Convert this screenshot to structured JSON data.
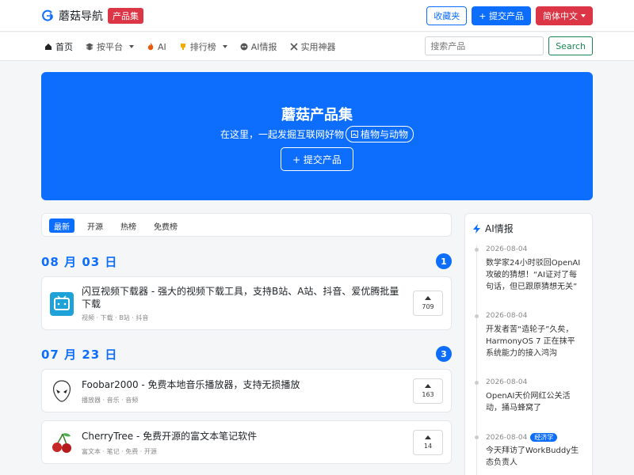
{
  "brand": {
    "name": "蘑菇导航",
    "badge": "产品集"
  },
  "top_actions": {
    "favorites": "收藏夹",
    "submit": "+ 提交产品",
    "language": "简体中文"
  },
  "nav": {
    "items": [
      {
        "label": "首页",
        "icon": "home-icon"
      },
      {
        "label": "按平台",
        "icon": "layers-icon"
      },
      {
        "label": "AI",
        "icon": "fire-icon"
      },
      {
        "label": "排行榜",
        "icon": "trophy-icon"
      },
      {
        "label": "AI情报",
        "icon": "robot-icon"
      },
      {
        "label": "实用神器",
        "icon": "tools-icon"
      }
    ],
    "search_placeholder": "搜索产品",
    "search_button": "Search"
  },
  "hero": {
    "title": "蘑菇产品集",
    "subtitle": "在这里，一起发掘互联网好物",
    "tag": "植物与动物",
    "button": "+ 提交产品"
  },
  "tabs": [
    "最新",
    "开源",
    "热榜",
    "免费榜"
  ],
  "groups": [
    {
      "date": "08 月 03 日",
      "count": "1",
      "products": [
        {
          "title": "闪豆视频下载器 - 强大的视频下载工具，支持B站、A站、抖音、爱优腾批量下载",
          "tags": "视频 · 下载 · B站 · 抖音",
          "votes": "709"
        }
      ]
    },
    {
      "date": "07 月 23 日",
      "count": "3",
      "products": [
        {
          "title": "Foobar2000 - 免费本地音乐播放器，支持无损播放",
          "tags": "播放器 · 音乐 · 音频",
          "votes": "163"
        },
        {
          "title": "CherryTree - 免费开源的富文本笔记软件",
          "tags": "富文本 · 笔记 · 免费 · 开源",
          "votes": "14"
        }
      ]
    }
  ],
  "sidebar": {
    "title": "AI情报",
    "news": [
      {
        "date": "2026-08-04",
        "text": "数学家24小时驳回OpenAI攻破的猜想！“AI证对了每句话，但已跟原猜想无关”"
      },
      {
        "date": "2026-08-04",
        "text": "开发者苦“造轮子”久矣，HarmonyOS 7 正在抹平系统能力的接入鸿沟"
      },
      {
        "date": "2026-08-04",
        "text": "OpenAI天价网红公关活动，捅马蜂窝了"
      },
      {
        "date": "2026-08-04",
        "tag": "经济学",
        "text": "今天拜访了WorkBuddy生态负责人"
      }
    ]
  }
}
